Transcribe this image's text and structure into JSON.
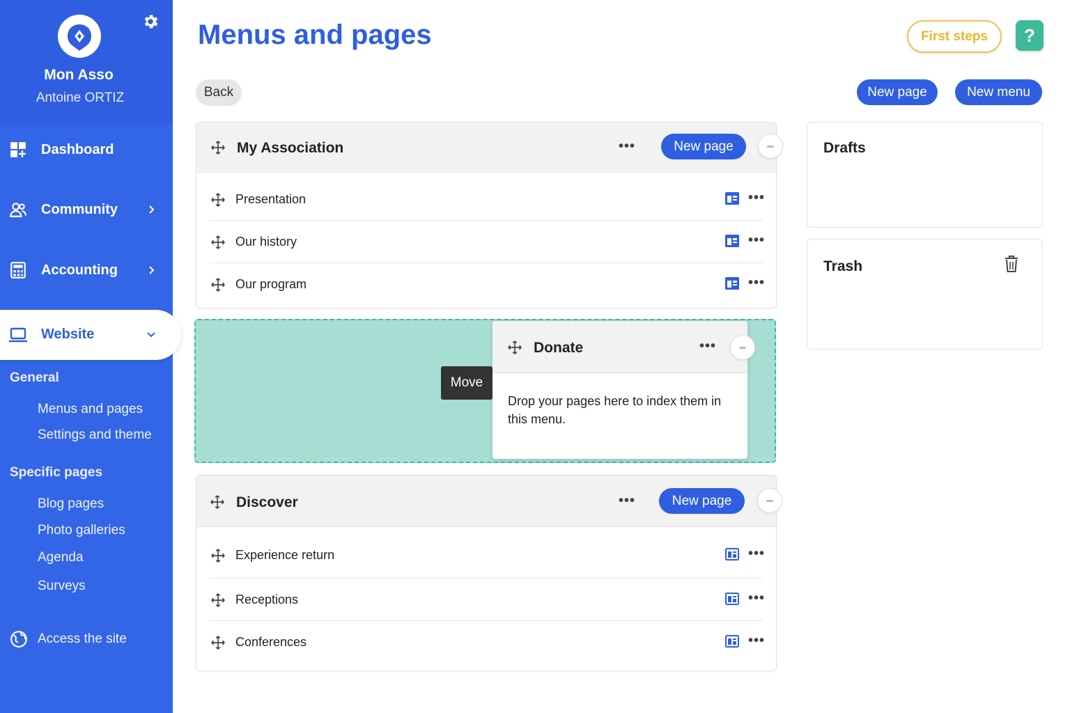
{
  "sidebar": {
    "org_name": "Mon Asso",
    "user_name": "Antoine ORTIZ",
    "nav": [
      {
        "label": "Dashboard",
        "icon": "dashboard-icon"
      },
      {
        "label": "Community",
        "icon": "community-icon"
      },
      {
        "label": "Accounting",
        "icon": "accounting-icon"
      },
      {
        "label": "Website",
        "icon": "laptop-icon"
      }
    ],
    "sections": [
      {
        "title": "General",
        "links": [
          "Menus and pages",
          "Settings and theme"
        ]
      },
      {
        "title": "Specific pages",
        "links": [
          "Blog pages",
          "Photo galleries",
          "Agenda",
          "Surveys"
        ]
      }
    ],
    "access_label": "Access the site"
  },
  "header": {
    "title": "Menus and pages",
    "first_steps": "First steps",
    "help": "?",
    "back": "Back",
    "new_page": "New page",
    "new_menu": "New menu"
  },
  "menus": [
    {
      "title": "My Association",
      "new_page": "New page",
      "pages": [
        "Presentation",
        "Our history",
        "Our program"
      ]
    },
    {
      "title": "Discover",
      "new_page": "New page",
      "pages": [
        "Experience return",
        "Receptions",
        "Conferences"
      ]
    }
  ],
  "dragging": {
    "title": "Donate",
    "empty_text": "Drop your pages here to index them in this menu.",
    "tooltip": "Move"
  },
  "panels": {
    "drafts": "Drafts",
    "trash": "Trash"
  },
  "colors": {
    "primary": "#2f5fe0",
    "sidebar": "#3366e6",
    "accent_green": "#3fb99a",
    "accent_yellow": "#f0b429",
    "dropzone": "#a6ded4"
  }
}
